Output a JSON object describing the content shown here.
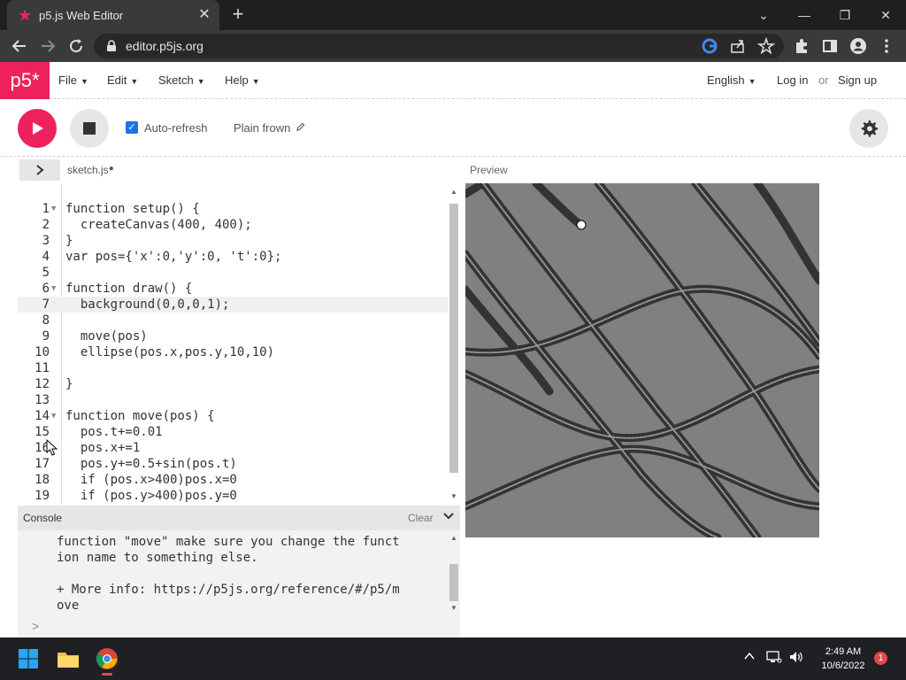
{
  "browser": {
    "tab_title": "p5.js Web Editor",
    "tab_close": "✕",
    "new_tab": "+",
    "url": "editor.p5js.org",
    "window_controls": [
      "⌄",
      "—",
      "❐",
      "✕"
    ]
  },
  "header": {
    "logo": "p5*",
    "menus": [
      {
        "label": "File"
      },
      {
        "label": "Edit"
      },
      {
        "label": "Sketch"
      },
      {
        "label": "Help"
      }
    ],
    "language": "English",
    "login": "Log in",
    "or": "or",
    "signup": "Sign up"
  },
  "toolbar": {
    "autorefresh_label": "Auto-refresh",
    "autorefresh_checked": true,
    "sketch_name": "Plain frown"
  },
  "editor": {
    "file_tab": "sketch.js",
    "preview_label": "Preview",
    "lines": [
      {
        "n": "1",
        "text": "function setup() {",
        "fold": true
      },
      {
        "n": "2",
        "text": "  createCanvas(400, 400);"
      },
      {
        "n": "3",
        "text": "}"
      },
      {
        "n": "4",
        "text": "var pos={'x':0,'y':0, 't':0};"
      },
      {
        "n": "5",
        "text": ""
      },
      {
        "n": "6",
        "text": "function draw() {",
        "fold": true
      },
      {
        "n": "7",
        "text": "  background(0,0,0,1);",
        "active": true
      },
      {
        "n": "8",
        "text": ""
      },
      {
        "n": "9",
        "text": "  move(pos)"
      },
      {
        "n": "10",
        "text": "  ellipse(pos.x,pos.y,10,10)"
      },
      {
        "n": "11",
        "text": ""
      },
      {
        "n": "12",
        "text": "}"
      },
      {
        "n": "13",
        "text": ""
      },
      {
        "n": "14",
        "text": "function move(pos) {",
        "fold": true
      },
      {
        "n": "15",
        "text": "  pos.t+=0.01"
      },
      {
        "n": "16",
        "text": "  pos.x+=1"
      },
      {
        "n": "17",
        "text": "  pos.y+=0.5+sin(pos.t)"
      },
      {
        "n": "18",
        "text": "  if (pos.x>400)pos.x=0"
      },
      {
        "n": "19",
        "text": "  if (pos.y>400)pos.y=0"
      }
    ]
  },
  "console": {
    "title": "Console",
    "clear": "Clear",
    "lines": [
      "function \"move\" make sure you change the funct",
      "ion name to something else.",
      "",
      "+ More info: https://p5js.org/reference/#/p5/m",
      "ove"
    ],
    "prompt": ">"
  },
  "taskbar": {
    "time": "2:49 AM",
    "date": "10/6/2022",
    "notifications": "1"
  },
  "colors": {
    "p5_pink": "#ed225d",
    "preview_bg": "#808080"
  }
}
